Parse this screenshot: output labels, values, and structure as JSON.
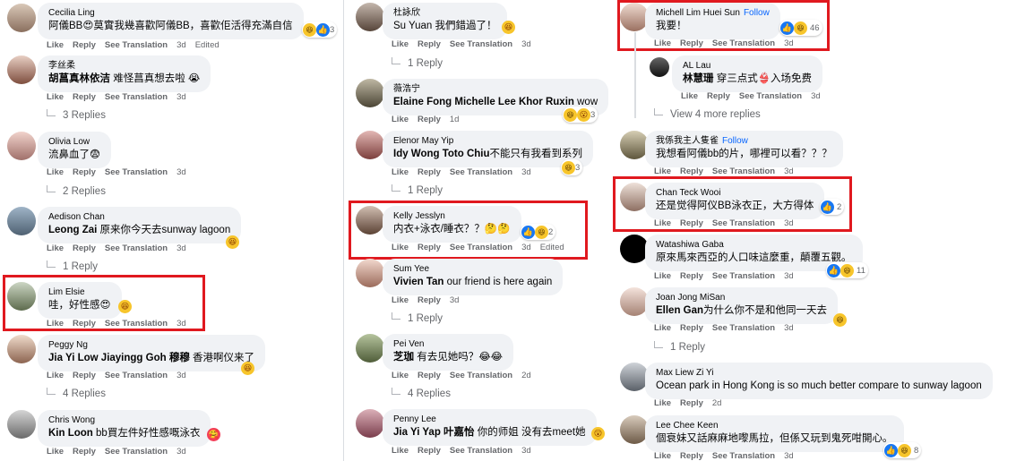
{
  "actions": {
    "like": "Like",
    "reply": "Reply",
    "translate": "See Translation",
    "edited": "Edited"
  },
  "col1": [
    {
      "name": "Cecilia Ling",
      "text": "阿儀BB😍莫實我幾喜歡阿儀BB，喜歡佢活得充滿自信",
      "time": "3d",
      "edited": "Edited",
      "count": "3"
    },
    {
      "name": "李丝柔",
      "tag": "胡菖真林依洁",
      "text": " 难怪菖真想去啦 😭",
      "time": "3d",
      "replies": "3 Replies"
    },
    {
      "name": "Olivia Low",
      "text": "流鼻血了😨",
      "time": "3d",
      "replies": "2 Replies"
    },
    {
      "name": "Aedison Chan",
      "tag": "Leong Zai",
      "text": " 原来你今天去sunway lagoon",
      "time": "3d",
      "replies": "1 Reply"
    },
    {
      "name": "Lim Elsie",
      "text": "哇，好性感😍",
      "time": "3d"
    },
    {
      "name": "Peggy Ng",
      "tag": "Jia Yi Low Jiayingg Goh 穆穆",
      "text": " 香港啊仪来了",
      "time": "3d",
      "replies": "4 Replies"
    },
    {
      "name": "Chris Wong",
      "tag": "Kin Loon",
      "text": " bb買左件好性感嘅泳衣",
      "time": "3d"
    }
  ],
  "col2": [
    {
      "name": "杜詠欣",
      "text": "Su Yuan 我們錯過了！",
      "time": "3d",
      "replies": "1 Reply"
    },
    {
      "name": "薇浩宁",
      "tag": "Elaine Fong Michelle Lee Khor Ruxin",
      "text": " wow",
      "time": "1d",
      "count": "3"
    },
    {
      "name": "Elenor May Yip",
      "tag": "Idy Wong Toto Chiu",
      "text": "不能只有我看到系列",
      "time": "3d",
      "count": "3",
      "replies": "1 Reply"
    },
    {
      "name": "Kelly Jesslyn",
      "text": "内衣+泳衣/睡衣？？🤔🤔",
      "time": "3d",
      "edited": "Edited",
      "count": "2"
    },
    {
      "name": "Sum Yee",
      "tag": "Vivien Tan",
      "text": " our friend is here again",
      "time": "3d",
      "replies": "1 Reply"
    },
    {
      "name": "Pei Ven",
      "tag": "芝珈",
      "text": " 有去见她吗？😂😂",
      "time": "2d",
      "replies": "4 Replies"
    },
    {
      "name": "Penny Lee",
      "tag": "Jia Yi Yap 叶嘉怡",
      "text": " 你的师姐 没有去meet她",
      "time": "3d"
    }
  ],
  "col3": [
    {
      "name": "Michell Lim Huei Sun",
      "follow": "Follow",
      "text": "我要！",
      "time": "3d",
      "count": "46"
    },
    {
      "name": "AL Lau",
      "tag": "林慧珊",
      "text": " 穿三点式👙入场免费",
      "time": "3d"
    },
    {
      "name": "我係我主人隻雀",
      "follow": "Follow",
      "text": "我想看阿儀bb的片，哪裡可以看？？？",
      "time": "3d"
    },
    {
      "name": "Chan Teck Wooi",
      "text": "还是觉得阿仪BB泳衣正，大方得体",
      "time": "3d",
      "count": "2"
    },
    {
      "name": "Watashiwa Gaba",
      "text": "原來馬來西亞的人口味這麼重，顛覆五觀。",
      "time": "3d",
      "count": "11"
    },
    {
      "name": "Joan Jong MiSan",
      "tag": "Ellen Gan",
      "text": "为什么你不是和他同一天去",
      "time": "3d",
      "replies": "1 Reply"
    },
    {
      "name": "Max Liew Zi Yi",
      "text": "Ocean park in Hong Kong is so much better compare to sunway lagoon",
      "time": "2d"
    },
    {
      "name": "Lee Chee Keen",
      "text": "個衰妹又話麻麻地嚟馬拉，但係又玩到鬼死咁開心。",
      "time": "3d",
      "count": "8"
    }
  ],
  "view_more": "View 4 more replies",
  "colors": {
    "link": "#0866ff",
    "highlight": "#e0191f",
    "bubble": "#f0f2f5",
    "meta": "#65676b"
  }
}
